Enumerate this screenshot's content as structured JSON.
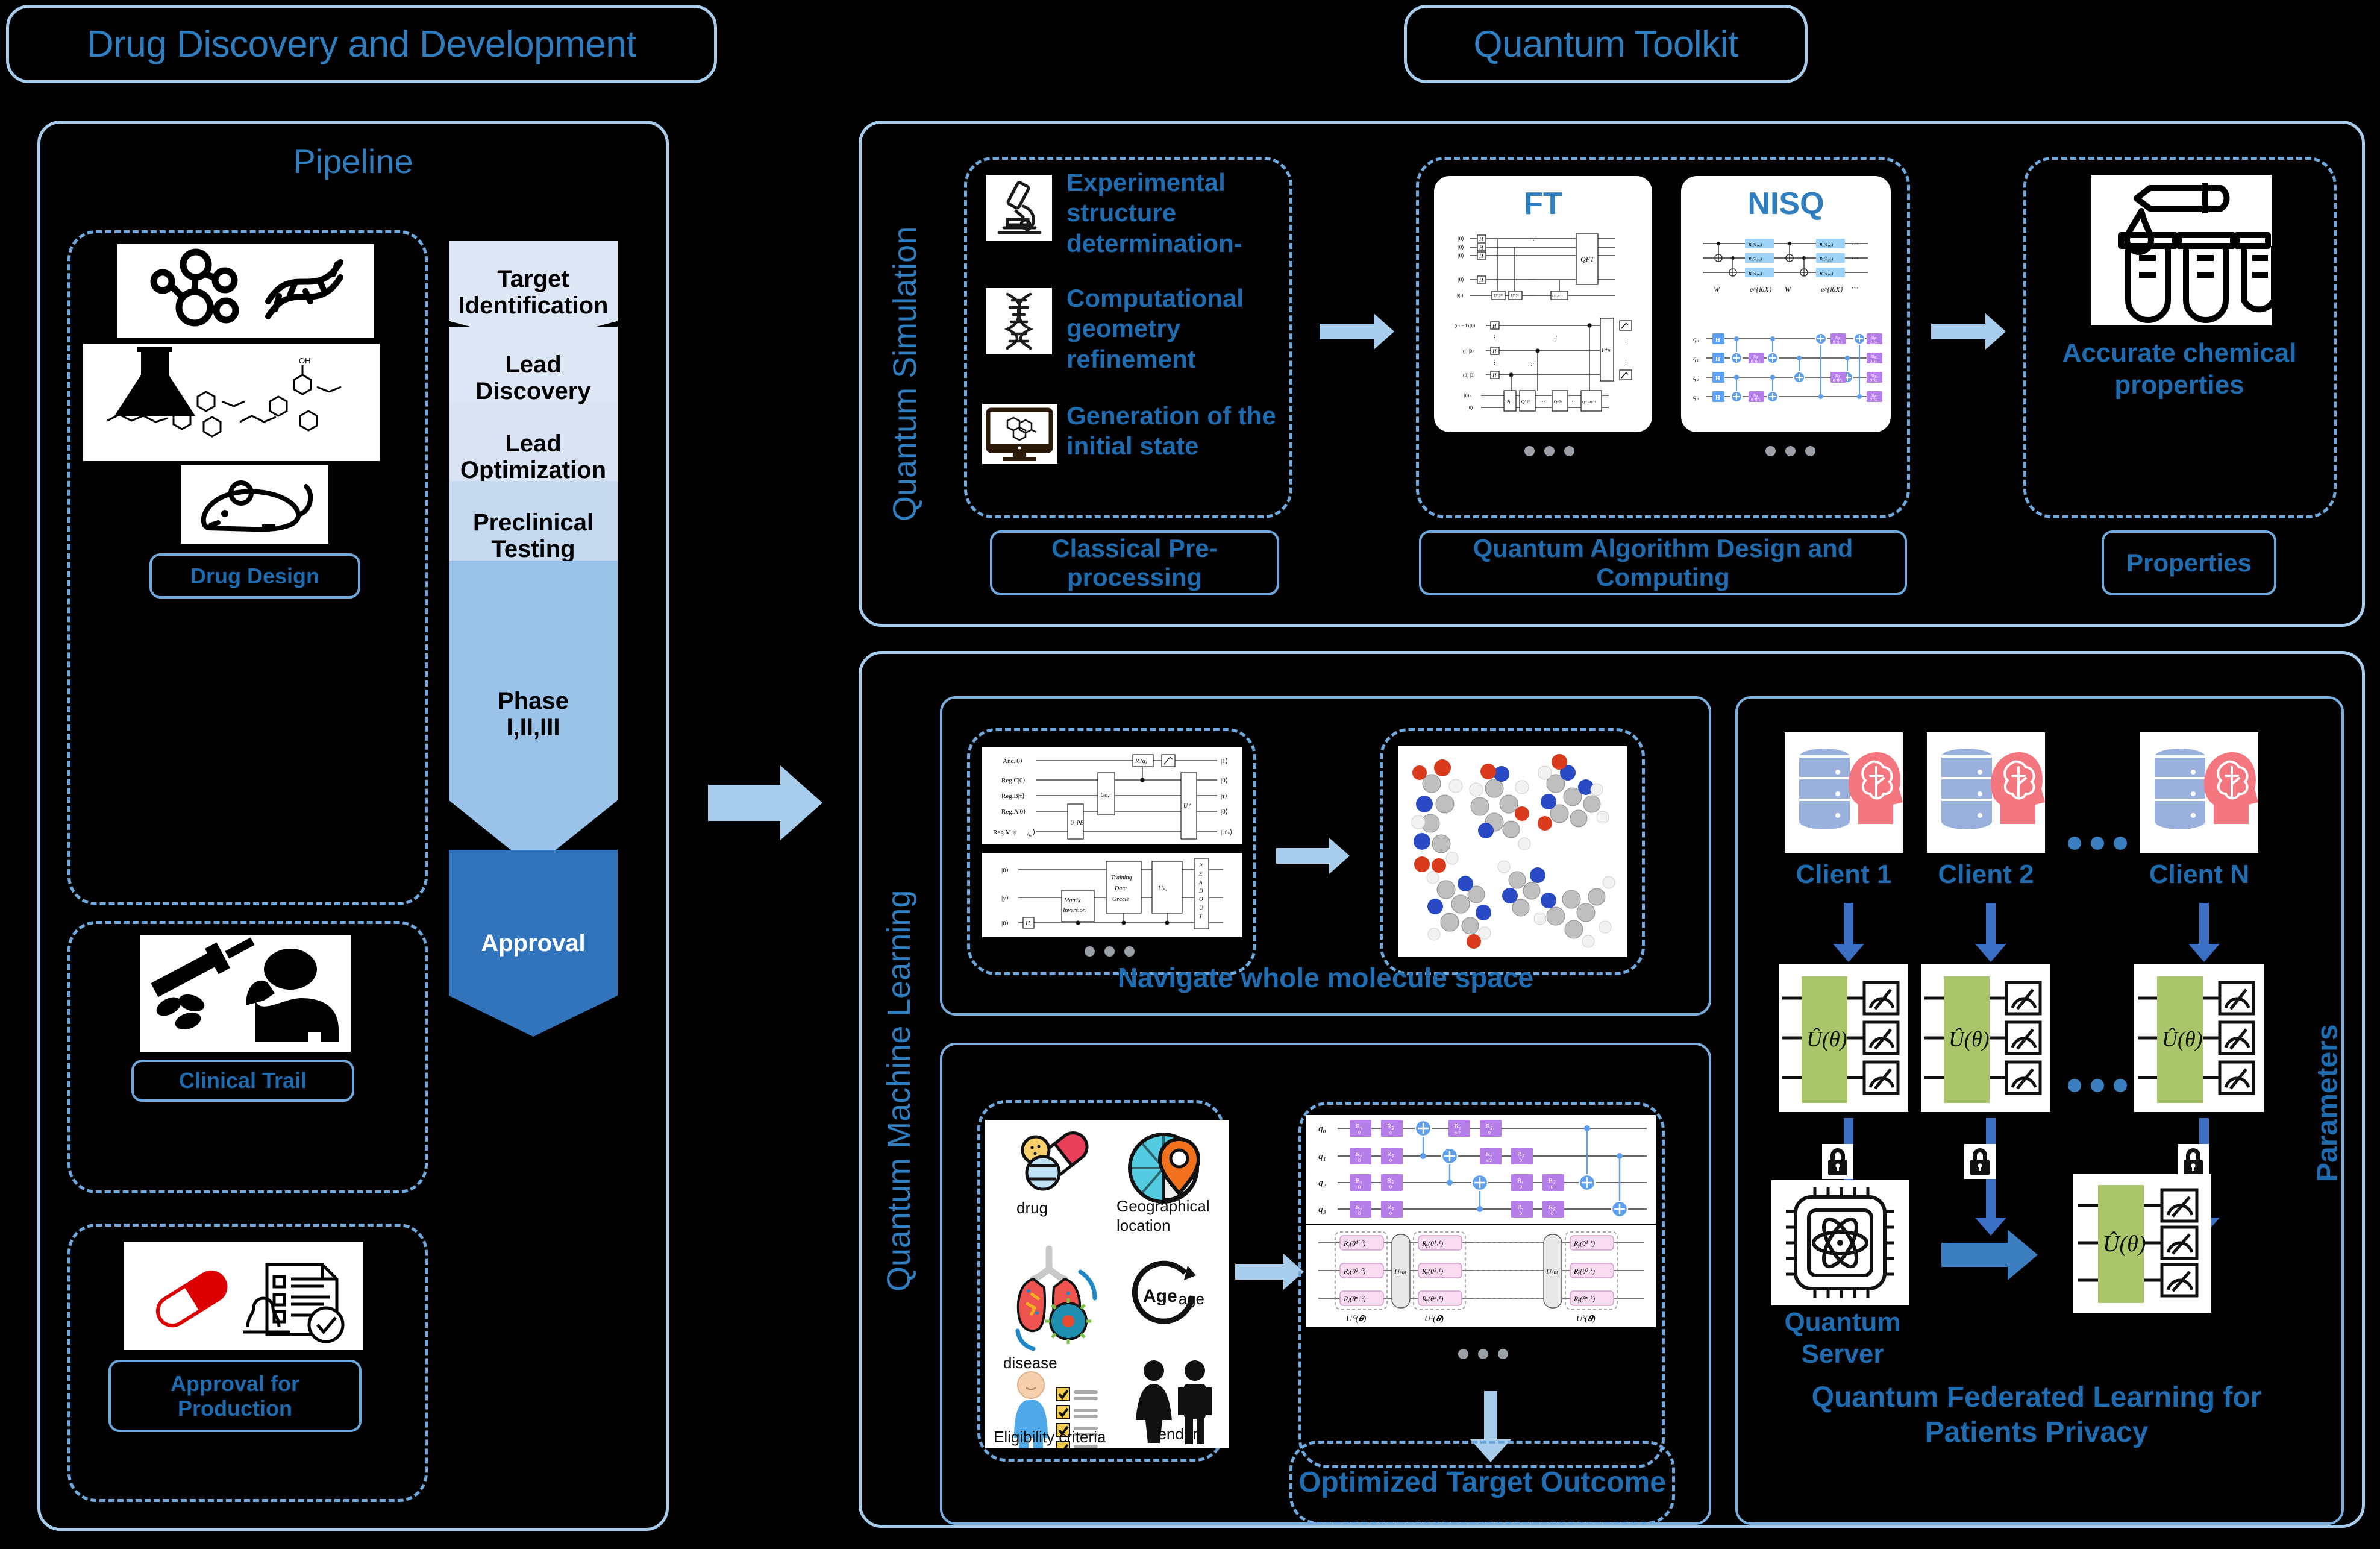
{
  "left_panel": {
    "title": "Drug Discovery and Development",
    "subtitle": "Pipeline",
    "stages": [
      {
        "label": "Target\nIdentification",
        "color": "#dee7f5",
        "text_color": "#000000"
      },
      {
        "label": "Lead\nDiscovery",
        "color": "#dde6f4",
        "text_color": "#000000"
      },
      {
        "label": "Lead\nOptimization",
        "color": "#d9e3f3",
        "text_color": "#000000"
      },
      {
        "label": "Preclinical\nTesting",
        "color": "#c5d9ef",
        "text_color": "#000000"
      },
      {
        "label": "Phase\nI,II,III",
        "color": "#9bc3ea",
        "text_color": "#000000"
      },
      {
        "label": "Approval",
        "color": "#3274bb",
        "text_color": "#ffffff"
      }
    ],
    "groups": [
      {
        "caption": "Drug Design",
        "icons": [
          "molecule-icon",
          "dna-icon",
          "flask-icon",
          "chemical-structure-icon",
          "mouse-icon"
        ]
      },
      {
        "caption": "Clinical Trail",
        "icons": [
          "syringe-pills-patient-icon"
        ]
      },
      {
        "caption": "Approval for Production",
        "icons": [
          "capsule-icon",
          "approved-document-icon"
        ]
      }
    ]
  },
  "right_panel": {
    "title": "Quantum Toolkit",
    "simulation": {
      "vertical_label": "Quantum Simulation",
      "steps": [
        {
          "icon": "microscope-icon",
          "text": "Experimental structure determination-"
        },
        {
          "icon": "dna-helix-icon",
          "text": "Computational geometry refinement"
        },
        {
          "icon": "monitor-molecule-icon",
          "text": "Generation of the initial state"
        }
      ],
      "caption_left": "Classical Pre-processing",
      "algorithms": [
        {
          "name": "FT",
          "ellipsis": "• • •"
        },
        {
          "name": "NISQ",
          "ellipsis": "• • •"
        }
      ],
      "caption_middle": "Quantum Algorithm Design and Computing",
      "properties_text": "Accurate chemical properties",
      "caption_right": "Properties",
      "ft_circuit": {
        "kets": [
          "|0⟩",
          "|0⟩",
          "|0⟩",
          "|0⟩",
          "|ψ⟩"
        ],
        "gates": [
          "H",
          "H",
          "H",
          "H",
          "U^{2^0}",
          "U^{2^1}",
          "U^{2^n-1}",
          "QFT"
        ],
        "labels2": [
          "(m − 1) |0⟩",
          "(j) |0⟩",
          "(0) |0⟩",
          "|0⟩ₙ",
          "|0⟩"
        ],
        "gates2": [
          "H",
          "H",
          "H",
          "A",
          "Q^{2^0}",
          "Q^{2^j}",
          "Q^{2^{m-1}}",
          "F†m"
        ]
      },
      "nisq_circuit": {
        "rotation_gates": [
          "Rₓ(θ₁,₁)",
          "Rₓ(θ₂,₁)",
          "Rₓ(θ₃,₁)"
        ],
        "block_labels": [
          "W",
          "e^{iθX}",
          "W",
          "e^{iθX}"
        ],
        "qubits": [
          "q₀",
          "q₁",
          "q₂",
          "q₃"
        ],
        "h_gate": "H",
        "rz_values": [
          "0.785",
          "2.36"
        ],
        "rz_label": "Rᴢ"
      }
    },
    "machine_learning": {
      "vertical_label": "Quantum Machine Learning",
      "caption_top": "Navigate whole molecule space",
      "hhl_circuit": {
        "registers": [
          "Anc.|0⟩",
          "Reg.C|0⟩",
          "Reg.B|τ⟩",
          "Reg.A|0⟩",
          "Reg.M|ψₐ₀⟩"
        ],
        "outputs": [
          "|1⟩",
          "|0⟩",
          "|τ⟩",
          "|0⟩",
          "|ψ'ₛ⟩"
        ],
        "gates": [
          "Rᵧ(α)",
          "Uσ,τ",
          "Uₚₑ",
          "U⁺"
        ]
      },
      "qml_circuit": {
        "kets": [
          "|0⟩",
          "|y⟩",
          "|0⟩"
        ],
        "gates": [
          "H",
          "Matrix Inversion",
          "Training Data Oracle",
          "Uₓ₀"
        ],
        "readout": "READOUT"
      },
      "features": [
        {
          "icon": "drug-pills-icon",
          "label": "drug"
        },
        {
          "icon": "geo-location-icon",
          "label": "Geographical location"
        },
        {
          "icon": "lungs-disease-icon",
          "label": "disease"
        },
        {
          "icon": "age-icon",
          "label": "age"
        },
        {
          "icon": "eligibility-checklist-icon",
          "label": "Eligibility criteria"
        },
        {
          "icon": "gender-icon",
          "label": "gender"
        }
      ],
      "vqc_circuit": {
        "qubits": [
          "q₀",
          "q₁",
          "q₂",
          "q₃"
        ],
        "gate_ry": "Rᵧ",
        "gate_rz": "Rᴢ",
        "param_zero": "0",
        "param_halfpi": "π/2",
        "ansatz_gates": [
          "Rᵧ(θ¹ᐟ⁰)",
          "Rᵧ(θ²ᐟ⁰)",
          "Rᵧ(θⁿᐟ⁰)",
          "Rᵧ(θ¹ᐟ¹)",
          "Rᵧ(θ²ᐟ¹)",
          "Rᵧ(θⁿᐟ¹)",
          "Rᵧ(θ¹ᐟᵏ)",
          "Rᵧ(θ²ᐟᵏ)",
          "Rᵧ(θⁿᐟᵏ)"
        ],
        "ent_label": "Uₑₙₜ",
        "layer_labels": [
          "U⁰(θ)",
          "U¹(θ)",
          "Uᵏ(θ)"
        ]
      },
      "caption_bottom": "Optimized Target Outcome"
    },
    "federated": {
      "clients": [
        "Client 1",
        "Client 2",
        "Client N"
      ],
      "unitary_label": "Û(θ)",
      "lock_icon": "lock-icon",
      "server_label": "Quantum Server",
      "parameters_label": "Parameters",
      "caption": "Quantum Federated Learning for Patients Privacy"
    }
  },
  "colors": {
    "background": "#000000",
    "accent_blue": "#2f7ec0",
    "light_blue": "#a8cdec",
    "dash_blue": "#6fa8dc",
    "dark_arrow": "#3a6fc4",
    "gate_green": "#a9c66b",
    "gate_purple": "#b57ee8",
    "gate_blue": "#5f9ff0"
  }
}
